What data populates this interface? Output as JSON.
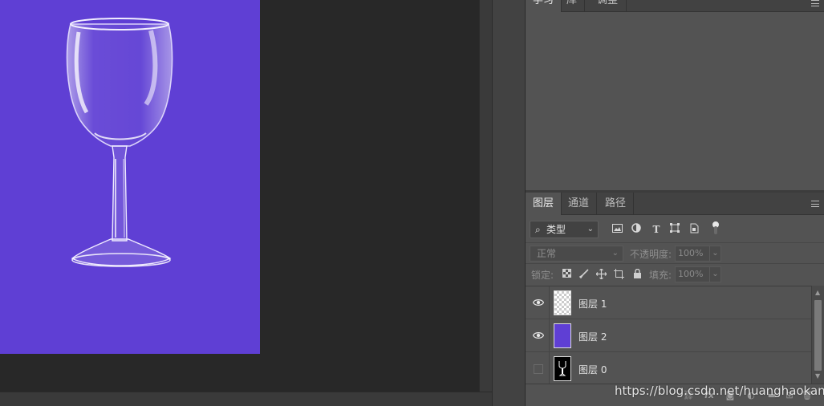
{
  "colors": {
    "canvas_fill": "#5f3fd4",
    "workspace": "#282828",
    "panel": "#535353",
    "tabbar": "#424242"
  },
  "top_panel": {
    "tabs": [
      {
        "label": "学习",
        "active": true
      },
      {
        "label": "库",
        "active": false
      },
      {
        "label": "调整",
        "active": false
      }
    ],
    "menu_icon": "panel-menu-icon"
  },
  "layers_panel": {
    "tabs": [
      {
        "label": "图层",
        "active": true
      },
      {
        "label": "通道",
        "active": false
      },
      {
        "label": "路径",
        "active": false
      }
    ],
    "filter": {
      "kind_label": "类型",
      "search_icon": "search-icon",
      "filter_icons": [
        "image-filter-icon",
        "adjustment-filter-icon",
        "type-filter-icon",
        "shape-filter-icon",
        "smart-object-filter-icon",
        "filter-toggle-icon"
      ]
    },
    "blend_mode": "正常",
    "opacity_label": "不透明度:",
    "opacity_value": "100%",
    "lock_label": "锁定:",
    "lock_icons": [
      "lock-transparent-icon",
      "lock-paint-icon",
      "lock-move-icon",
      "lock-artboard-icon",
      "lock-all-icon"
    ],
    "fill_label": "填充:",
    "fill_value": "100%",
    "layers": [
      {
        "name": "图层 1",
        "visible": true,
        "thumbnail": "transparent"
      },
      {
        "name": "图层 2",
        "visible": true,
        "thumbnail": "purple-fill"
      },
      {
        "name": "图层 0",
        "visible": false,
        "thumbnail": "glass-on-black"
      }
    ],
    "footer_icons": [
      "link-icon",
      "fx-icon",
      "mask-icon",
      "adjustment-icon",
      "folder-icon",
      "new-layer-icon",
      "trash-icon"
    ]
  },
  "watermark": "https://blog.csdn.net/huanghaokang"
}
